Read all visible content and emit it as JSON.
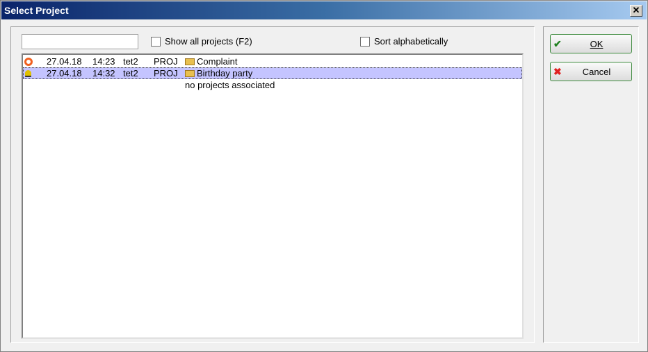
{
  "window": {
    "title": "Select Project",
    "close": "✕"
  },
  "search": {
    "value": ""
  },
  "show_all": {
    "label": "Show all projects (F2)",
    "checked": false
  },
  "sort_alpha": {
    "label": "Sort alphabetically",
    "checked": false
  },
  "rows": [
    {
      "status": "orange-ring",
      "date": "27.04.18",
      "time": "14:23",
      "user": "tet2",
      "type": "PROJ",
      "name": "Complaint",
      "selected": false
    },
    {
      "status": "yellow-bell",
      "date": "27.04.18",
      "time": "14:32",
      "user": "tet2",
      "type": "PROJ",
      "name": "Birthday party",
      "selected": true
    }
  ],
  "note": "no projects associated",
  "buttons": {
    "ok": "OK",
    "cancel": "Cancel"
  }
}
